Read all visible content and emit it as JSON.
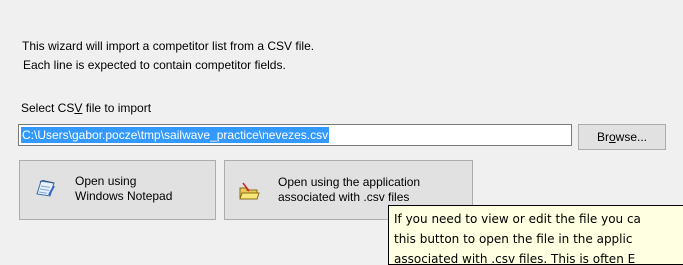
{
  "intro": {
    "line1": "This wizard will import a competitor list from a CSV file.",
    "line2": "Each line is expected to contain competitor fields."
  },
  "file": {
    "label_prefix": "Select CS",
    "label_accel": "V",
    "label_suffix": " file to import",
    "path": "C:\\Users\\gabor.pocze\\tmp\\sailwave_practice\\nevezes.csv"
  },
  "browse": {
    "prefix": "Br",
    "accel": "o",
    "suffix": "wse..."
  },
  "buttons": {
    "notepad": {
      "line1": "Open using",
      "line2": "Windows Notepad",
      "icon": "notepad-icon"
    },
    "app": {
      "line1": "Open using the application",
      "line2": "associated with .csv files",
      "icon": "open-folder-icon"
    }
  },
  "tooltip": {
    "line1": "If you need to view or edit the file you ca",
    "line2": "this button to open the file in the applic",
    "line3": "associated with .csv files. This is often E"
  }
}
